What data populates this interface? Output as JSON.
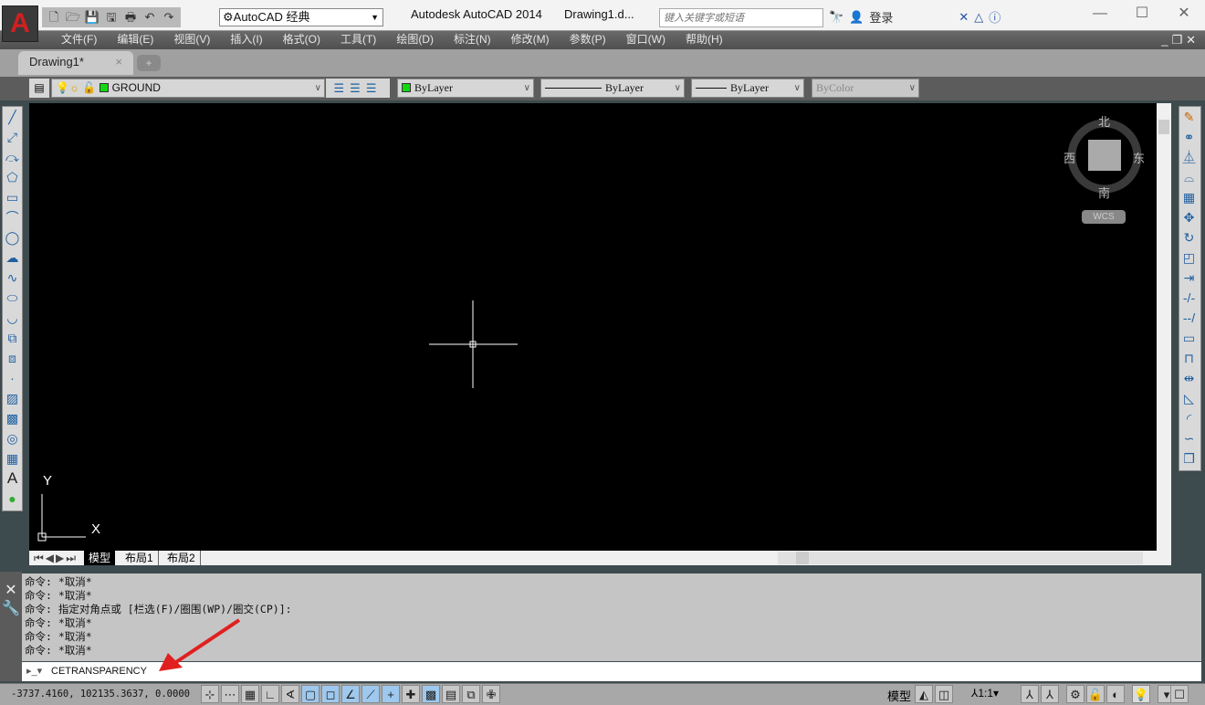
{
  "app": {
    "logo": "A",
    "title": "Autodesk AutoCAD 2014",
    "document": "Drawing1.d...",
    "workspace": "AutoCAD 经典",
    "search_placeholder": "键入关键字或短语",
    "login": "登录"
  },
  "quick_access": [
    "new-icon",
    "open-icon",
    "save-icon",
    "saveas-icon",
    "print-icon",
    "undo-icon",
    "redo-icon"
  ],
  "window_controls": [
    "minimize",
    "maximize",
    "close"
  ],
  "menu": [
    "文件(F)",
    "编辑(E)",
    "视图(V)",
    "插入(I)",
    "格式(O)",
    "工具(T)",
    "绘图(D)",
    "标注(N)",
    "修改(M)",
    "参数(P)",
    "窗口(W)",
    "帮助(H)"
  ],
  "tabs": {
    "active": "Drawing1*"
  },
  "properties": {
    "layer": "GROUND",
    "layer_color": "#11d911",
    "color": "ByLayer",
    "linetype": "ByLayer",
    "lineweight": "ByLayer",
    "plotstyle": "ByColor"
  },
  "viewcube": {
    "north": "北",
    "south": "南",
    "east": "东",
    "west": "西",
    "wcs": "WCS"
  },
  "ucs": {
    "x": "X",
    "y": "Y"
  },
  "layout_tabs": [
    "模型",
    "布局1",
    "布局2"
  ],
  "command_history": [
    "命令: *取消*",
    "命令: *取消*",
    "命令: 指定对角点或 [栏选(F)/圈围(WP)/圈交(CP)]:",
    "命令: *取消*",
    "命令: *取消*",
    "命令: *取消*"
  ],
  "command_input": "CETRANSPARENCY",
  "status": {
    "coords": "-3737.4160,  102135.3637, 0.0000",
    "model": "模型",
    "scale": "1:1"
  },
  "left_tools": [
    "line",
    "xline",
    "polyline",
    "polygon",
    "rectangle",
    "arc",
    "circle",
    "revcloud",
    "spline",
    "ellipse",
    "ellipse-arc",
    "insert-block",
    "make-block",
    "point",
    "hatch",
    "gradient",
    "region",
    "table",
    "mtext",
    "add-selected"
  ],
  "right_tools": [
    "erase",
    "copy",
    "mirror",
    "offset",
    "array",
    "move",
    "rotate",
    "scale",
    "stretch",
    "trim",
    "extend",
    "break-at-point",
    "break",
    "join",
    "chamfer",
    "fillet",
    "blend",
    "explode"
  ]
}
